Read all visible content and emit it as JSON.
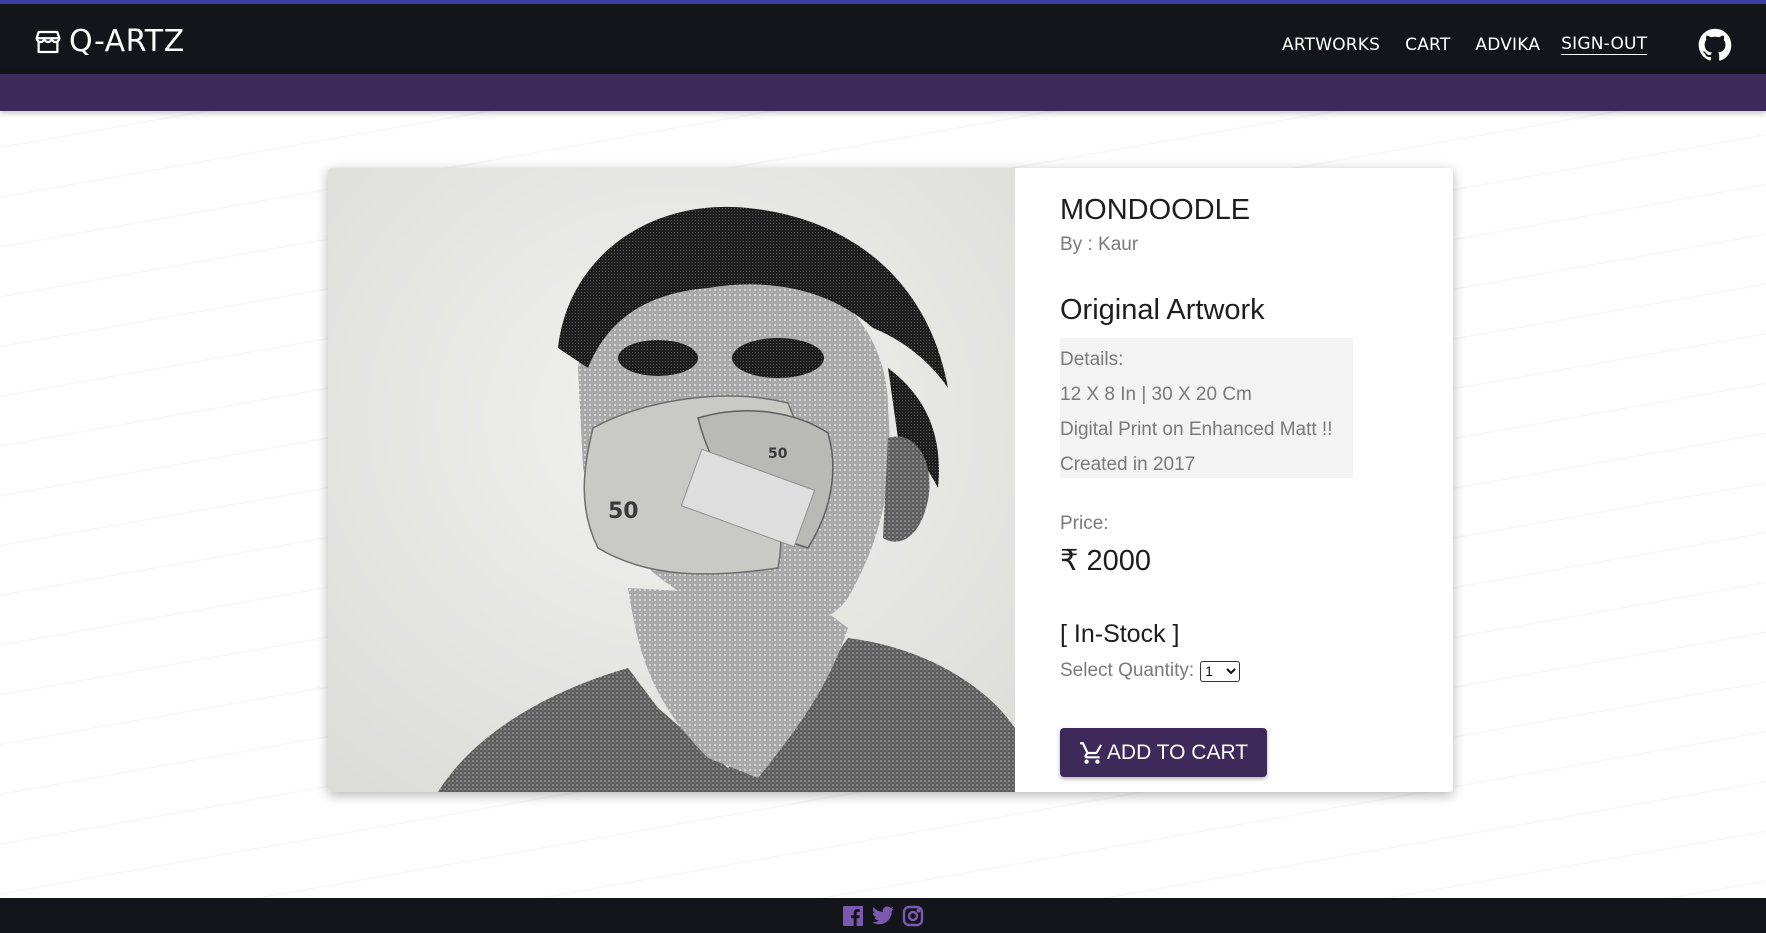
{
  "brand": {
    "name": "Q-ARTZ",
    "icon": "storefront-icon"
  },
  "nav": {
    "links": [
      "ARTWORKS",
      "CART",
      "ADVIKA",
      "SIGN-OUT"
    ],
    "github_icon": "github-icon"
  },
  "colors": {
    "navbar": "#14151a",
    "accent_bar": "#3b3fa6",
    "subbar": "#3d2a5a",
    "button": "#3d2a5a",
    "social_icons": "#7a5ab0"
  },
  "product": {
    "title": "MONDOODLE",
    "artist_prefix": "By : ",
    "artist": "Kaur",
    "type": "Original Artwork",
    "details": {
      "heading": "Details:",
      "size": "12 X 8 In | 30 X 20 Cm",
      "medium": "Digital Print on Enhanced Matt !!",
      "created": "Created in 2017"
    },
    "price_label": "Price:",
    "price": "₹ 2000",
    "stock": "[ In-Stock ]",
    "quantity_label": "Select Quantity:",
    "quantity_selected": "1",
    "add_to_cart": "ADD TO CART"
  },
  "footer": {
    "social_icons": [
      "facebook-icon",
      "twitter-icon",
      "instagram-icon"
    ]
  }
}
